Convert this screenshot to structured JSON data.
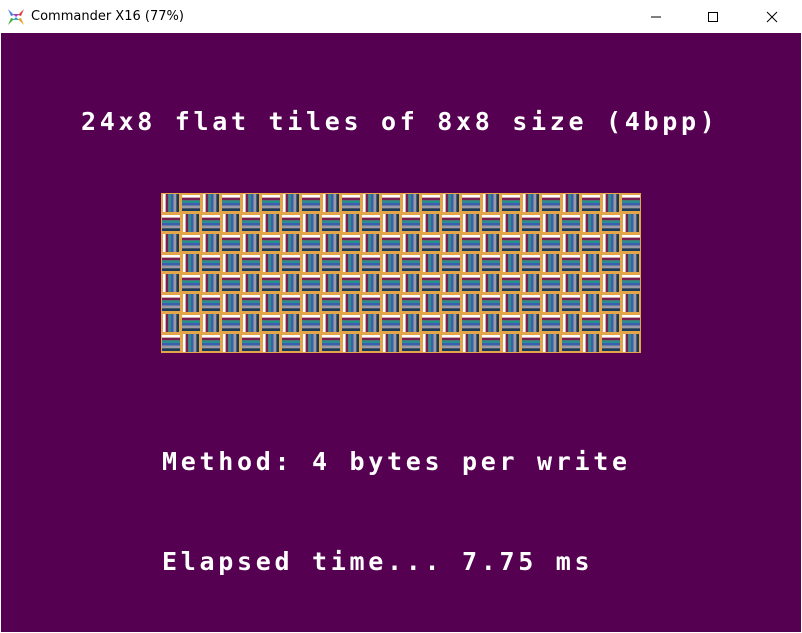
{
  "window": {
    "title": "Commander X16 (77%)",
    "icon": "x16-logo-icon",
    "controls": [
      "minimize-icon",
      "maximize-icon",
      "close-icon"
    ]
  },
  "screen": {
    "background": "#560052",
    "text_color": "#ffffff",
    "heading": "24x8 flat tiles of 8x8 size (4bpp)",
    "method": "Method: 4 bytes per write",
    "elapsed": "Elapsed time... 7.75 ms"
  },
  "tiles": {
    "columns": 24,
    "rows": 8,
    "tile_pixels": 8,
    "stripe_colors": [
      "#ffffff",
      "#7a1f4f",
      "#2a8f8f",
      "#3a5fb0",
      "#9a9aa8",
      "#1a3a5a",
      "#e3a548"
    ]
  }
}
